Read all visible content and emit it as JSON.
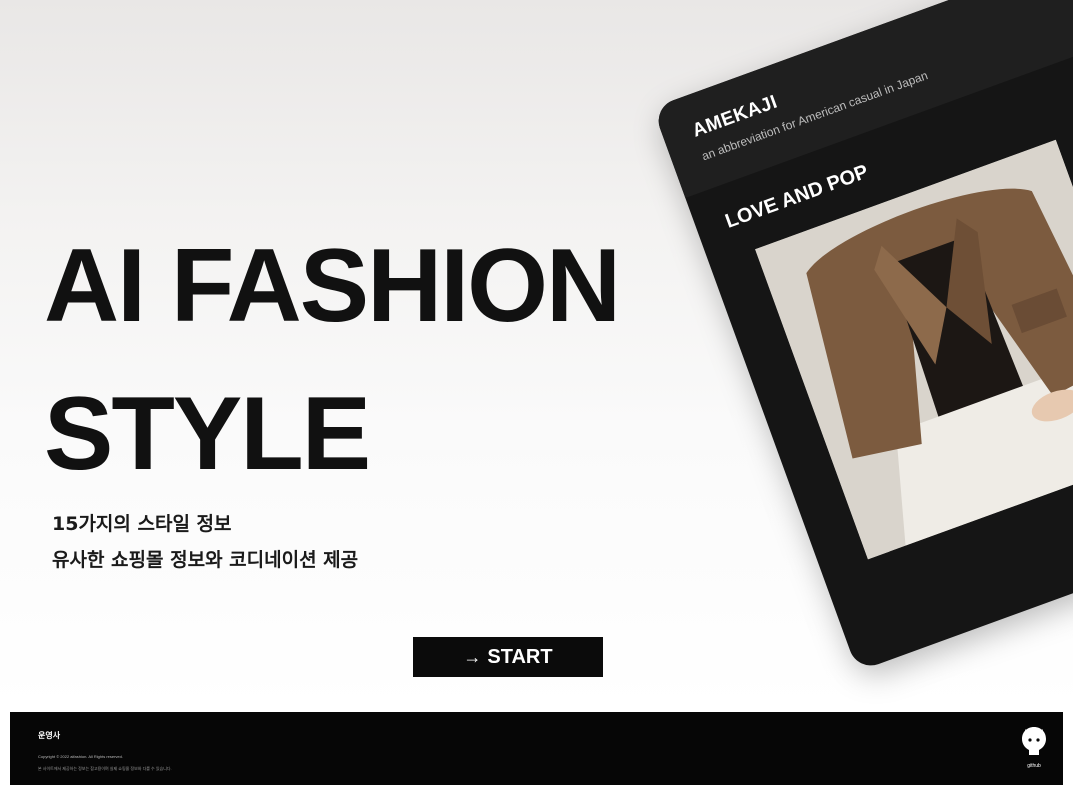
{
  "hero": {
    "title_line1": "AI FASHION",
    "title_line2": "STYLE",
    "subtitle_line1": "15가지의 스타일 정보",
    "subtitle_line2": "유사한 쇼핑몰 정보와 코디네이션 제공",
    "start_label": "START",
    "start_icon": "arrow-right-icon"
  },
  "card": {
    "title": "AMEKAJI",
    "description": "an abbreviation for American casual in Japan",
    "section_title": "LOVE AND POP"
  },
  "footer": {
    "brand": "운영사",
    "copyright": "Copyright © 2022 aifashion. All Rights reserved.",
    "notice": "본 사이트에서 제공하는 정보는 참고용이며 실제 쇼핑몰 정보와 다를 수 있습니다.",
    "github_label": "github",
    "github_icon": "github-icon"
  },
  "colors": {
    "background": "#ffffff",
    "card": "#151515",
    "footer": "#060606",
    "button": "#0b0b0b",
    "text": "#111111"
  }
}
